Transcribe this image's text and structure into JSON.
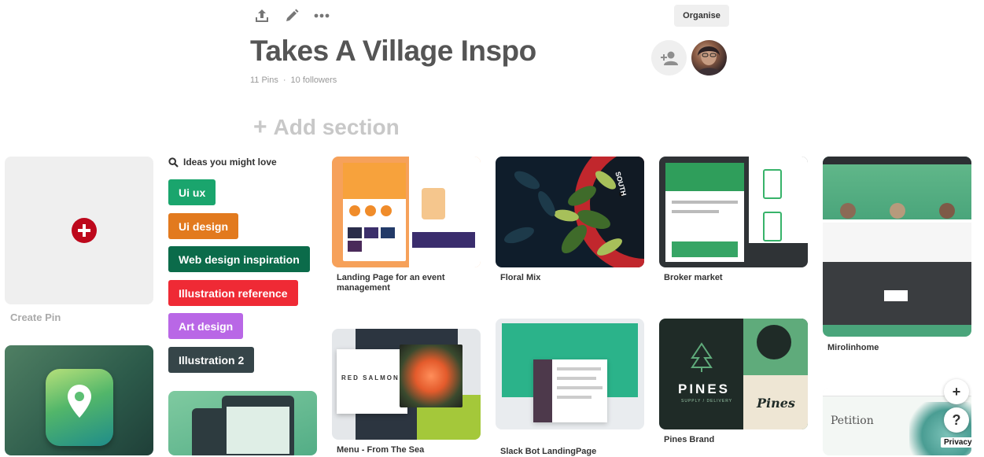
{
  "toolbar": {
    "share_icon": "share-upload-icon",
    "edit_icon": "pencil-icon",
    "more_icon": "ellipsis-icon",
    "organise_label": "Organise"
  },
  "board": {
    "title": "Takes A Village Inspo",
    "pins_count": "11 Pins",
    "separator": "·",
    "followers": "10 followers",
    "add_section": "Add section"
  },
  "create_pin": {
    "label": "Create Pin",
    "accent": "#bd081c"
  },
  "ideas": {
    "heading": "Ideas you might love",
    "chips": [
      {
        "label": "Ui ux",
        "color": "#1aa56d"
      },
      {
        "label": "Ui design",
        "color": "#e27a1e"
      },
      {
        "label": "Web design inspiration",
        "color": "#0b6b4a"
      },
      {
        "label": "Illustration reference",
        "color": "#ef2a35"
      },
      {
        "label": "Art design",
        "color": "#b967e6"
      },
      {
        "label": "Illustration 2",
        "color": "#364549"
      }
    ]
  },
  "pins": [
    {
      "title": "Landing Page for an event management"
    },
    {
      "title": "Floral Mix"
    },
    {
      "title": "Broker market"
    },
    {
      "title": "Mirolinhome"
    },
    {
      "title": "Menu - From The Sea"
    },
    {
      "title": "Slack Bot LandingPage"
    },
    {
      "title": "Pines Brand"
    }
  ],
  "pin_text": {
    "south": "SOUTH",
    "red_salmon": "RED SALMON",
    "pines": "PINES",
    "pines_sub": "SUPPLY / DELIVERY",
    "pines_script": "Pines",
    "petition": "Petition"
  },
  "floating": {
    "plus_label": "+",
    "help_label": "?",
    "privacy_label": "Privacy"
  }
}
